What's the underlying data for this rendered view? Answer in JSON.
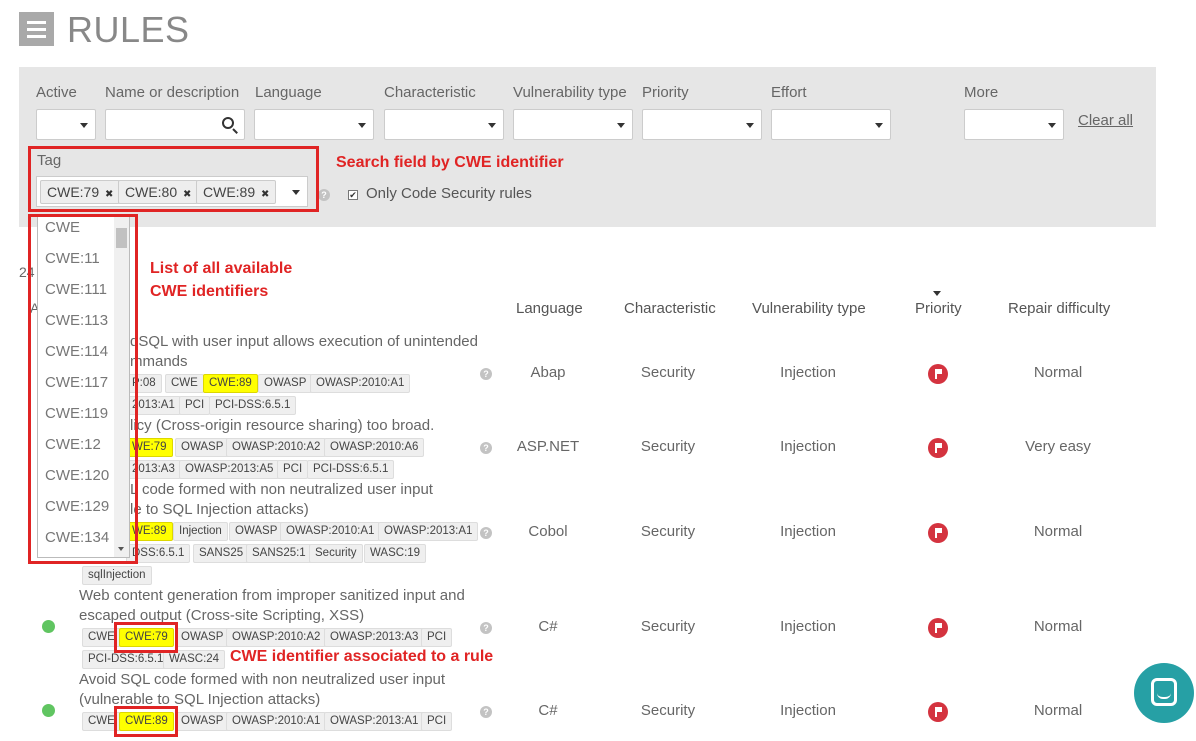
{
  "header": {
    "title": "RULES"
  },
  "filters": {
    "labels": [
      "Active",
      "Name or description",
      "Language",
      "Characteristic",
      "Vulnerability type",
      "Priority",
      "Effort",
      "More"
    ],
    "clear_all": "Clear all",
    "tag_label": "Tag",
    "tag_chips": [
      "CWE:79",
      "CWE:80",
      "CWE:89"
    ],
    "chip_remove": "✖",
    "only_security_label": "Only Code Security rules",
    "checkbox_mark": "✔"
  },
  "annotations": {
    "search_field": "Search field by CWE identifier",
    "list_line1": "List of all available",
    "list_line2": "CWE identifiers",
    "rule_tag": "CWE identifier associated to a rule"
  },
  "cwe_list": [
    "CWE",
    "CWE:11",
    "CWE:111",
    "CWE:113",
    "CWE:114",
    "CWE:117",
    "CWE:119",
    "CWE:12",
    "CWE:120",
    "CWE:129",
    "CWE:134"
  ],
  "partial_text": {
    "count": "24",
    "col": "A"
  },
  "table": {
    "headers": {
      "language": "Language",
      "characteristic": "Characteristic",
      "vulnerability": "Vulnerability type",
      "priority": "Priority",
      "repair": "Repair difficulty"
    },
    "rows": [
      {
        "title_lines": [
          "dSQL with user input allows execution of unintended",
          "mmands"
        ],
        "tag_lines": [
          [
            "P:08",
            "CWE",
            "CWE:89",
            "OWASP",
            "OWASP:2010:A1"
          ],
          [
            "2013:A1",
            "PCI",
            "PCI-DSS:6.5.1"
          ]
        ],
        "language": "Abap",
        "characteristic": "Security",
        "vulnerability": "Injection",
        "repair": "Normal"
      },
      {
        "title_lines": [
          "licy (Cross-origin resource sharing) too broad."
        ],
        "tag_lines": [
          [
            "WE:79",
            "OWASP",
            "OWASP:2010:A2",
            "OWASP:2010:A6"
          ],
          [
            "2013:A3",
            "OWASP:2013:A5",
            "PCI",
            "PCI-DSS:6.5.1"
          ]
        ],
        "language": "ASP.NET",
        "characteristic": "Security",
        "vulnerability": "Injection",
        "repair": "Very easy"
      },
      {
        "title_lines": [
          "L code formed with non neutralized user input",
          "le to SQL Injection attacks)"
        ],
        "tag_lines": [
          [
            "WE:89",
            "Injection",
            "OWASP",
            "OWASP:2010:A1",
            "OWASP:2013:A1"
          ],
          [
            "DSS:6.5.1",
            "SANS25",
            "SANS25:1",
            "Security",
            "WASC:19"
          ],
          [
            "sqlInjection"
          ]
        ],
        "language": "Cobol",
        "characteristic": "Security",
        "vulnerability": "Injection",
        "repair": "Normal"
      },
      {
        "title_lines": [
          "Web content generation from improper sanitized input and",
          "escaped output (Cross-site Scripting, XSS)"
        ],
        "tag_lines": [
          [
            "CWE",
            "CWE:79",
            "OWASP",
            "OWASP:2010:A2",
            "OWASP:2013:A3",
            "PCI"
          ],
          [
            "PCI-DSS:6.5.1",
            "WASC:24"
          ]
        ],
        "language": "C#",
        "characteristic": "Security",
        "vulnerability": "Injection",
        "repair": "Normal"
      },
      {
        "title_lines": [
          "Avoid SQL code formed with non neutralized user input",
          "(vulnerable to SQL Injection attacks)"
        ],
        "tag_lines": [
          [
            "CWE",
            "CWE:89",
            "OWASP",
            "OWASP:2010:A1",
            "OWASP:2013:A1",
            "PCI"
          ]
        ],
        "language": "C#",
        "characteristic": "Security",
        "vulnerability": "Injection",
        "repair": "Normal"
      }
    ]
  },
  "colors": {
    "highlight": "#ffff00",
    "annotation_red": "#e02424",
    "priority_red": "#d4333f",
    "active_green": "#60c561",
    "chat": "#26a0a5"
  }
}
